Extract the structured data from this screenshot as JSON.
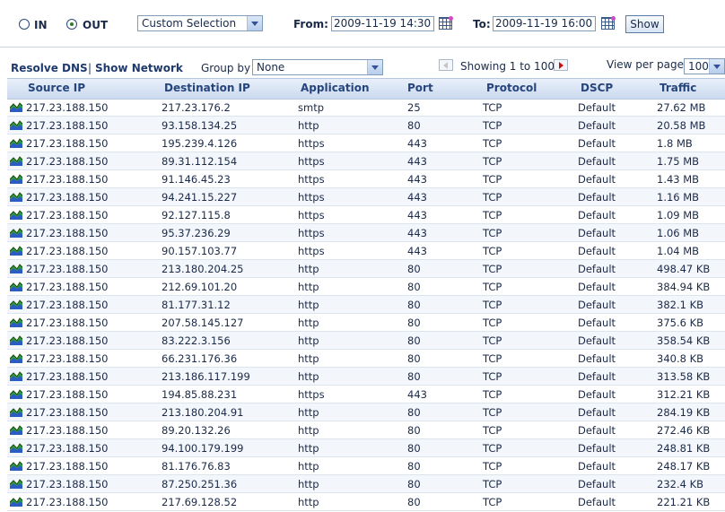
{
  "filter": {
    "in_label": "IN",
    "out_label": "OUT",
    "selected_direction": "OUT",
    "range_select": "Custom Selection",
    "from_label": "From:",
    "from_value": "2009-11-19 14:30",
    "to_label": "To:",
    "to_value": "2009-11-19 16:00",
    "show_label": "Show"
  },
  "toolbar": {
    "resolve_dns": "Resolve DNS",
    "separator": "|",
    "show_network": "Show Network",
    "group_by_label": "Group by",
    "group_by_value": "None",
    "showing": "Showing 1 to 100",
    "view_per_page_label": "View per page",
    "view_per_page_value": "100"
  },
  "table": {
    "columns": [
      "Source IP",
      "Destination IP",
      "Application",
      "Port",
      "Protocol",
      "DSCP",
      "Traffic"
    ],
    "rows": [
      [
        "217.23.188.150",
        "217.23.176.2",
        "smtp",
        "25",
        "TCP",
        "Default",
        "27.62 MB"
      ],
      [
        "217.23.188.150",
        "93.158.134.25",
        "http",
        "80",
        "TCP",
        "Default",
        "20.58 MB"
      ],
      [
        "217.23.188.150",
        "195.239.4.126",
        "https",
        "443",
        "TCP",
        "Default",
        "1.8 MB"
      ],
      [
        "217.23.188.150",
        "89.31.112.154",
        "https",
        "443",
        "TCP",
        "Default",
        "1.75 MB"
      ],
      [
        "217.23.188.150",
        "91.146.45.23",
        "https",
        "443",
        "TCP",
        "Default",
        "1.43 MB"
      ],
      [
        "217.23.188.150",
        "94.241.15.227",
        "https",
        "443",
        "TCP",
        "Default",
        "1.16 MB"
      ],
      [
        "217.23.188.150",
        "92.127.115.8",
        "https",
        "443",
        "TCP",
        "Default",
        "1.09 MB"
      ],
      [
        "217.23.188.150",
        "95.37.236.29",
        "https",
        "443",
        "TCP",
        "Default",
        "1.06 MB"
      ],
      [
        "217.23.188.150",
        "90.157.103.77",
        "https",
        "443",
        "TCP",
        "Default",
        "1.04 MB"
      ],
      [
        "217.23.188.150",
        "213.180.204.25",
        "http",
        "80",
        "TCP",
        "Default",
        "498.47 KB"
      ],
      [
        "217.23.188.150",
        "212.69.101.20",
        "http",
        "80",
        "TCP",
        "Default",
        "384.94 KB"
      ],
      [
        "217.23.188.150",
        "81.177.31.12",
        "http",
        "80",
        "TCP",
        "Default",
        "382.1 KB"
      ],
      [
        "217.23.188.150",
        "207.58.145.127",
        "http",
        "80",
        "TCP",
        "Default",
        "375.6 KB"
      ],
      [
        "217.23.188.150",
        "83.222.3.156",
        "http",
        "80",
        "TCP",
        "Default",
        "358.54 KB"
      ],
      [
        "217.23.188.150",
        "66.231.176.36",
        "http",
        "80",
        "TCP",
        "Default",
        "340.8 KB"
      ],
      [
        "217.23.188.150",
        "213.186.117.199",
        "http",
        "80",
        "TCP",
        "Default",
        "313.58 KB"
      ],
      [
        "217.23.188.150",
        "194.85.88.231",
        "https",
        "443",
        "TCP",
        "Default",
        "312.21 KB"
      ],
      [
        "217.23.188.150",
        "213.180.204.91",
        "http",
        "80",
        "TCP",
        "Default",
        "284.19 KB"
      ],
      [
        "217.23.188.150",
        "89.20.132.26",
        "http",
        "80",
        "TCP",
        "Default",
        "272.46 KB"
      ],
      [
        "217.23.188.150",
        "94.100.179.199",
        "http",
        "80",
        "TCP",
        "Default",
        "248.81 KB"
      ],
      [
        "217.23.188.150",
        "81.176.76.83",
        "http",
        "80",
        "TCP",
        "Default",
        "248.17 KB"
      ],
      [
        "217.23.188.150",
        "87.250.251.36",
        "http",
        "80",
        "TCP",
        "Default",
        "232.4 KB"
      ],
      [
        "217.23.188.150",
        "217.69.128.52",
        "http",
        "80",
        "TCP",
        "Default",
        "221.21 KB"
      ]
    ]
  },
  "icons": {
    "row_graph": "area-graph-icon",
    "calendar": "calendar-icon",
    "prev": "prev-page-icon",
    "next": "next-page-icon"
  }
}
